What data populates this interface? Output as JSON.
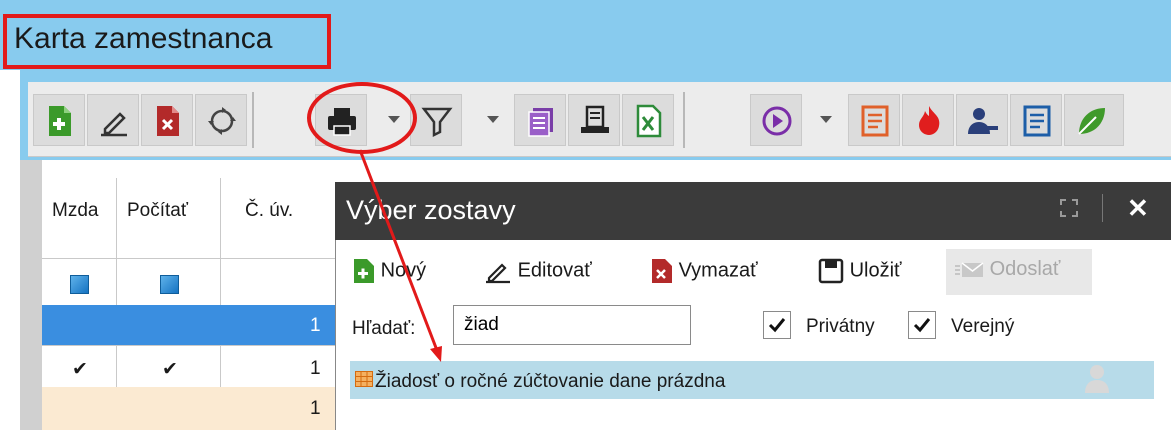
{
  "window": {
    "title": "Karta zamestnanca"
  },
  "toolbar": {
    "buttons": [
      {
        "name": "new-record",
        "icon": "new-doc-icon"
      },
      {
        "name": "edit",
        "icon": "pencil-icon"
      },
      {
        "name": "delete",
        "icon": "delete-doc-icon"
      },
      {
        "name": "refresh",
        "icon": "refresh-icon"
      },
      {
        "name": "print",
        "icon": "printer-icon"
      },
      {
        "name": "filter",
        "icon": "filter-icon"
      },
      {
        "name": "list",
        "icon": "list-icon"
      },
      {
        "name": "report",
        "icon": "report-icon"
      },
      {
        "name": "excel",
        "icon": "excel-icon"
      },
      {
        "name": "run",
        "icon": "play-icon"
      },
      {
        "name": "doc-orange",
        "icon": "doc-icon"
      },
      {
        "name": "fire",
        "icon": "fire-icon"
      },
      {
        "name": "user-minus",
        "icon": "user-icon"
      },
      {
        "name": "doc-blue",
        "icon": "doc-icon"
      },
      {
        "name": "leaf",
        "icon": "leaf-icon"
      }
    ]
  },
  "grid": {
    "columns": [
      "Mzda",
      "Počítať",
      "Č. úv."
    ],
    "rows": [
      {
        "mzda": "checked-square",
        "pocitat": "checked-square",
        "cuv": ""
      },
      {
        "mzda": "",
        "pocitat": "",
        "cuv": "1",
        "selected": true
      },
      {
        "mzda": "✔",
        "pocitat": "✔",
        "cuv": "1"
      },
      {
        "mzda": "",
        "pocitat": "",
        "cuv": "1"
      }
    ]
  },
  "dialog": {
    "title": "Výber zostavy",
    "actions": {
      "new": "Nový",
      "edit": "Editovať",
      "delete": "Vymazať",
      "save": "Uložiť",
      "send": "Odoslať"
    },
    "search": {
      "label": "Hľadať:",
      "value": "žiad"
    },
    "filters": {
      "private": {
        "label": "Privátny",
        "checked": true
      },
      "public": {
        "label": "Verejný",
        "checked": true
      }
    },
    "results": [
      {
        "label": "Žiadosť o ročné zúčtovanie dane prázdna"
      }
    ]
  },
  "colors": {
    "titlebar": "#88cbee",
    "annotation": "#e21a1a",
    "selection": "#3a8ee0",
    "highlight": "#b7dbe9"
  }
}
